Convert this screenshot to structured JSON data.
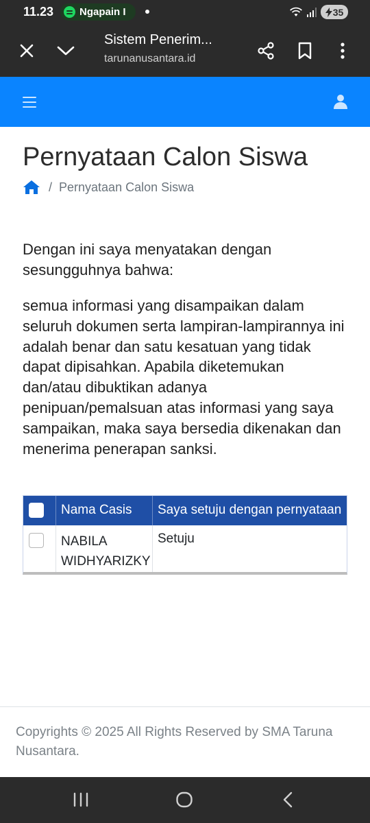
{
  "status_bar": {
    "time": "11.23",
    "media_app_text": "Ngapain I",
    "battery_level": "35",
    "icons": [
      "spotify-icon",
      "wifi-icon",
      "signal-icon",
      "battery-charging-icon"
    ]
  },
  "tab_header": {
    "title": "Sistem Penerim...",
    "url": "tarunanusantara.id",
    "icons": [
      "close-icon",
      "chevron-down-icon",
      "share-icon",
      "bookmark-icon",
      "more-vert-icon"
    ]
  },
  "navbar": {
    "color": "#0a84ff",
    "icons": [
      "hamburger-menu-icon",
      "user-icon"
    ]
  },
  "page": {
    "title": "Pernyataan Calon Siswa",
    "breadcrumb": {
      "home_icon": "home-icon",
      "separator": "/",
      "current": "Pernyataan Calon Siswa"
    }
  },
  "statement": {
    "intro": "Dengan ini saya menyatakan dengan sesungguhnya bahwa:",
    "body": "semua informasi yang disampaikan dalam seluruh dokumen serta lampiran-lampirannya ini adalah benar dan satu kesatuan yang tidak dapat dipisahkan. Apabila diketemukan dan/atau dibuktikan adanya penipuan/pemalsuan atas informasi yang saya sampaikan, maka saya bersedia dikenakan dan menerima penerapan sanksi."
  },
  "table": {
    "header_color": "#1f4fa6",
    "columns": [
      "Nama Casis",
      "Saya setuju dengan pernyataan"
    ],
    "rows": [
      {
        "name": "NABILA WIDHYARIZKY",
        "agreement": "Setuju",
        "checked": false
      }
    ]
  },
  "footer": {
    "text": "Copyrights © 2025 All Rights Reserved by SMA Taruna Nusantara."
  },
  "system_nav": {
    "icons": [
      "recent-apps-icon",
      "home-circle-icon",
      "back-icon"
    ]
  }
}
